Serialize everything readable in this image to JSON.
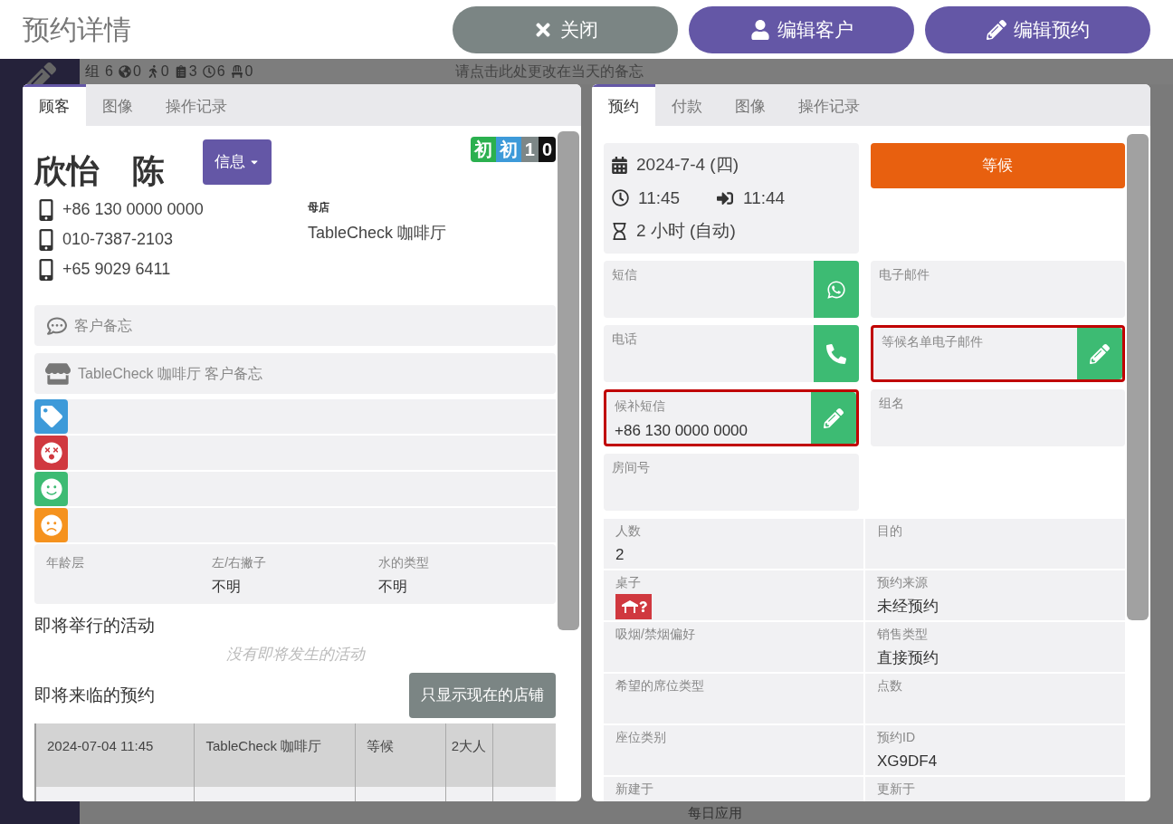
{
  "header": {
    "title": "预约详情",
    "buttons": [
      {
        "kind": "close",
        "label": "关闭"
      },
      {
        "kind": "customer",
        "label": "编辑客户"
      },
      {
        "kind": "reservation",
        "label": "编辑预约"
      }
    ]
  },
  "background": {
    "stats": [
      {
        "kind": "group",
        "value": "组"
      },
      {
        "kind": "number",
        "value": "6"
      },
      {
        "kind": "globe",
        "value": "0"
      },
      {
        "kind": "walk",
        "value": "0"
      },
      {
        "kind": "list",
        "value": "3"
      },
      {
        "kind": "clock",
        "value": "6"
      },
      {
        "kind": "chair",
        "value": "0"
      }
    ],
    "memo": "请点击此处更改在当天的备忘",
    "footer_label": "每日应用"
  },
  "customer_panel": {
    "tabs": [
      {
        "label": "顾客",
        "selected": true
      },
      {
        "label": "图像",
        "selected": false
      },
      {
        "label": "操作记录",
        "selected": false
      }
    ],
    "badges": [
      {
        "label": "初",
        "color": "#2bb04f"
      },
      {
        "label": "初",
        "color": "#3d9ad9"
      },
      {
        "label": "1",
        "color": "#7d8787"
      },
      {
        "label": "0",
        "color": "#111111"
      }
    ],
    "name": "欣怡　陈",
    "info_button": "信息",
    "phones": [
      "+86 130 0000 0000",
      "010-7387-2103",
      "+65 9029 6411"
    ],
    "home_store": {
      "label": "母店",
      "value": "TableCheck 咖啡厅"
    },
    "notes": [
      {
        "kind": "chat",
        "label": "客户备忘"
      },
      {
        "kind": "store",
        "label": "TableCheck 咖啡厅 客户备忘"
      }
    ],
    "tags": [
      {
        "kind": "tag",
        "color": "#3d9ad9"
      },
      {
        "kind": "dizzy",
        "color": "#d0383f"
      },
      {
        "kind": "smile",
        "color": "#3dbb73"
      },
      {
        "kind": "frown",
        "color": "#f5921e"
      }
    ],
    "attributes": [
      {
        "label": "年龄层"
      },
      {
        "label": "左/右撇子",
        "value": "不明"
      },
      {
        "label": "水的类型",
        "value": "不明"
      }
    ],
    "events": {
      "title": "即将举行的活动",
      "empty": "没有即将发生的活动"
    },
    "upcoming": {
      "title": "即将来临的预约",
      "filter_button": "只显示现在的店铺",
      "rows": [
        [
          "2024-07-04 11:45",
          "TableCheck 咖啡厅",
          "等候",
          "2大人"
        ]
      ]
    }
  },
  "reservation_panel": {
    "tabs": [
      {
        "label": "预约",
        "selected": true
      },
      {
        "label": "付款",
        "selected": false
      },
      {
        "label": "图像",
        "selected": false
      },
      {
        "label": "操作记录",
        "selected": false
      }
    ],
    "date": "2024-7-4 (四)",
    "start": "11:45",
    "arrival": "11:44",
    "duration": "2 小时 (自动)",
    "status": "等候",
    "contacts": [
      {
        "label": "短信",
        "kind": "whatsapp",
        "highlighted": false
      },
      {
        "label": "电子邮件",
        "kind": "plain",
        "highlighted": false
      },
      {
        "label": "电话",
        "kind": "phone",
        "highlighted": false
      },
      {
        "label": "等候名单电子邮件",
        "kind": "edit",
        "highlighted": true
      },
      {
        "label": "候补短信",
        "value": "+86 130 0000 0000",
        "kind": "edit",
        "highlighted": true
      },
      {
        "label": "组名",
        "kind": "plain",
        "highlighted": false
      },
      {
        "label": "房间号",
        "kind": "plain",
        "highlighted": false
      }
    ],
    "details": [
      {
        "label": "人数",
        "value": "2"
      },
      {
        "label": "目的"
      },
      {
        "label": "桌子",
        "kind": "table_icon"
      },
      {
        "label": "预约来源",
        "value": "未经预约"
      },
      {
        "label": "吸烟/禁烟偏好"
      },
      {
        "label": "销售类型",
        "value": "直接预约"
      },
      {
        "label": "希望的席位类型"
      },
      {
        "label": "点数"
      },
      {
        "label": "座位类别"
      },
      {
        "label": "预约ID",
        "value": "XG9DF4"
      },
      {
        "label": "新建于"
      },
      {
        "label": "更新于"
      }
    ]
  }
}
